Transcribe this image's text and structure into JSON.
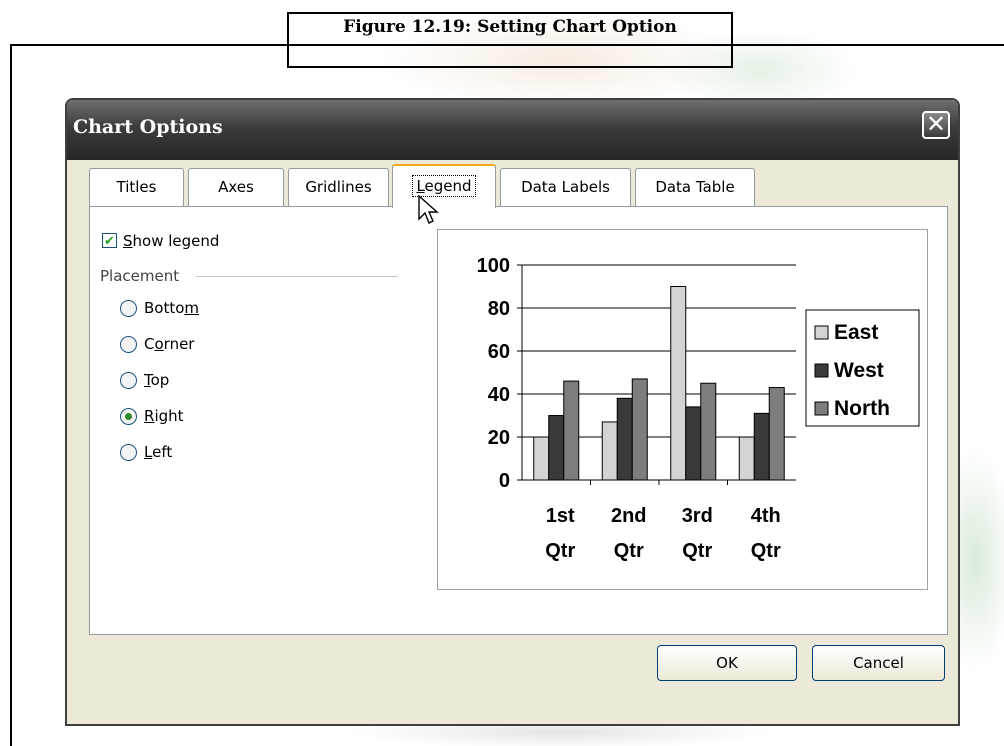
{
  "caption": "Figure 12.19: Setting Chart Option",
  "dialog": {
    "title": "Chart Options",
    "close_glyph": "✕",
    "tabs": [
      {
        "label": "Titles",
        "active": false
      },
      {
        "label": "Axes",
        "active": false
      },
      {
        "label": "Gridlines",
        "active": false
      },
      {
        "label": "Legend",
        "active": true
      },
      {
        "label": "Data Labels",
        "active": false
      },
      {
        "label": "Data Table",
        "active": false
      }
    ],
    "show_legend": {
      "label": "Show legend",
      "checked": true
    },
    "placement": {
      "label": "Placement",
      "options": [
        {
          "label": "Bottom",
          "selected": false
        },
        {
          "label": "Corner",
          "selected": false
        },
        {
          "label": "Top",
          "selected": false
        },
        {
          "label": "Right",
          "selected": true
        },
        {
          "label": "Left",
          "selected": false
        }
      ]
    },
    "buttons": {
      "ok": "OK",
      "cancel": "Cancel"
    }
  },
  "colors": {
    "east": "#d4d4d4",
    "west": "#3a3a3a",
    "north": "#7d7d7d",
    "accent_tab": "#f5a623"
  },
  "icons": {
    "cursor": "arrow-cursor-icon",
    "close": "close-icon",
    "check": "checkmark-icon"
  },
  "chart_data": {
    "type": "bar",
    "categories": [
      "1st Qtr",
      "2nd Qtr",
      "3rd Qtr",
      "4th Qtr"
    ],
    "category_lines": [
      [
        "1st",
        "Qtr"
      ],
      [
        "2nd",
        "Qtr"
      ],
      [
        "3rd",
        "Qtr"
      ],
      [
        "4th",
        "Qtr"
      ]
    ],
    "series": [
      {
        "name": "East",
        "values": [
          20,
          27,
          90,
          20
        ]
      },
      {
        "name": "West",
        "values": [
          30,
          38,
          34,
          31
        ]
      },
      {
        "name": "North",
        "values": [
          46,
          47,
          45,
          43
        ]
      }
    ],
    "y_ticks": [
      0,
      20,
      40,
      60,
      80,
      100
    ],
    "ylim": [
      0,
      100
    ],
    "grid": true,
    "legend_position": "right"
  }
}
